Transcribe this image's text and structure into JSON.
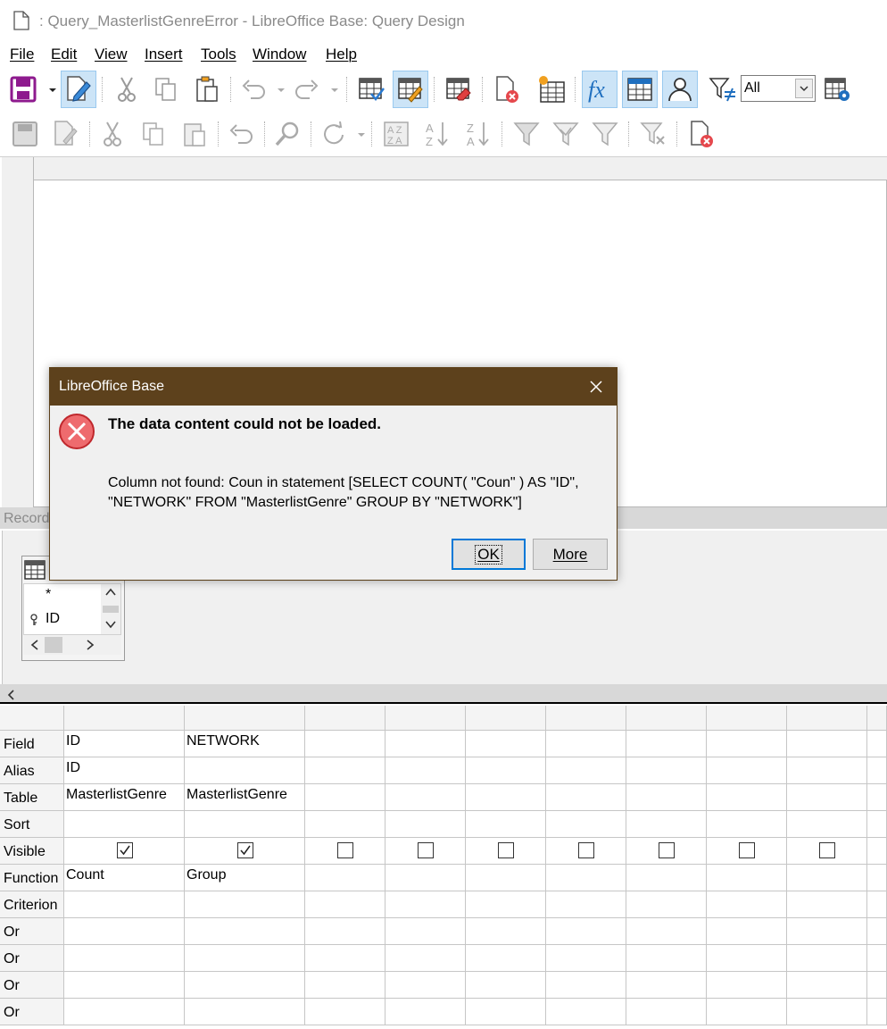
{
  "window": {
    "title": ": Query_MasterlistGenreError - LibreOffice Base: Query Design"
  },
  "menu": [
    "File",
    "Edit",
    "View",
    "Insert",
    "Tools",
    "Window",
    "Help"
  ],
  "toolbar": {
    "filter_value": "All"
  },
  "record_bar": {
    "label": "Record"
  },
  "table_window": {
    "fields": [
      "*",
      "ID"
    ]
  },
  "grid": {
    "row_labels": [
      "Field",
      "Alias",
      "Table",
      "Sort",
      "Visible",
      "Function",
      "Criterion",
      "Or",
      "Or",
      "Or",
      "Or"
    ],
    "columns": [
      {
        "field": "ID",
        "alias": "ID",
        "table": "MasterlistGenre",
        "sort": "",
        "visible": true,
        "function": "Count"
      },
      {
        "field": "NETWORK",
        "alias": "",
        "table": "MasterlistGenre",
        "sort": "",
        "visible": true,
        "function": "Group"
      },
      {
        "field": "",
        "alias": "",
        "table": "",
        "sort": "",
        "visible": false,
        "function": ""
      },
      {
        "field": "",
        "alias": "",
        "table": "",
        "sort": "",
        "visible": false,
        "function": ""
      },
      {
        "field": "",
        "alias": "",
        "table": "",
        "sort": "",
        "visible": false,
        "function": ""
      },
      {
        "field": "",
        "alias": "",
        "table": "",
        "sort": "",
        "visible": false,
        "function": ""
      },
      {
        "field": "",
        "alias": "",
        "table": "",
        "sort": "",
        "visible": false,
        "function": ""
      },
      {
        "field": "",
        "alias": "",
        "table": "",
        "sort": "",
        "visible": false,
        "function": ""
      },
      {
        "field": "",
        "alias": "",
        "table": "",
        "sort": "",
        "visible": false,
        "function": ""
      }
    ]
  },
  "dialog": {
    "title": "LibreOffice Base",
    "headline": "The data content could not be loaded.",
    "message": "Column not found: Coun in statement [SELECT COUNT( \"Coun\" ) AS \"ID\", \"NETWORK\" FROM \"MasterlistGenre\" GROUP BY \"NETWORK\"]",
    "ok_label": "OK",
    "more_label": "More"
  },
  "colors": {
    "dialog_title_bg": "#5d411c",
    "toggled_button_bg": "#cce4f7",
    "error_icon": "#e5484d"
  }
}
